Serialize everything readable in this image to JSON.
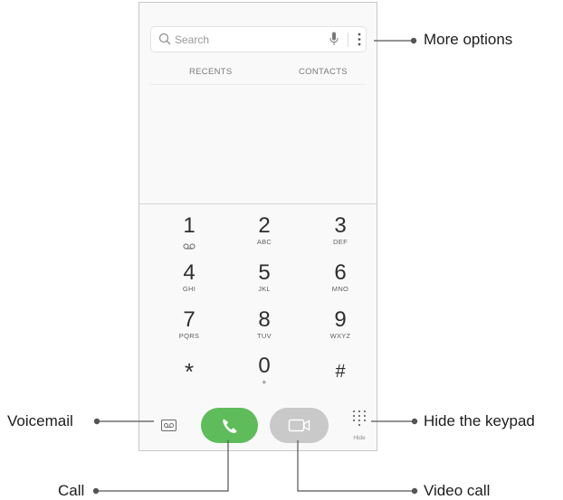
{
  "search": {
    "placeholder": "Search"
  },
  "tabs": [
    "RECENTS",
    "CONTACTS"
  ],
  "keypad": [
    {
      "digit": "1",
      "letters": ""
    },
    {
      "digit": "2",
      "letters": "ABC"
    },
    {
      "digit": "3",
      "letters": "DEF"
    },
    {
      "digit": "4",
      "letters": "GHI"
    },
    {
      "digit": "5",
      "letters": "JKL"
    },
    {
      "digit": "6",
      "letters": "MNO"
    },
    {
      "digit": "7",
      "letters": "PQRS"
    },
    {
      "digit": "8",
      "letters": "TUV"
    },
    {
      "digit": "9",
      "letters": "WXYZ"
    },
    {
      "digit": "*",
      "letters": ""
    },
    {
      "digit": "0",
      "letters": "+"
    },
    {
      "digit": "#",
      "letters": ""
    }
  ],
  "bottom": {
    "hide_label": "Hide"
  },
  "callouts": {
    "more_options": "More options",
    "voicemail": "Voicemail",
    "hide_keypad": "Hide the keypad",
    "call": "Call",
    "video_call": "Video call"
  },
  "colors": {
    "call_button": "#5fbc5a",
    "video_button": "#c9c9c9",
    "callout_line": "#555555"
  },
  "icons": [
    "search-icon",
    "mic-icon",
    "more-options-icon",
    "voicemail-icon",
    "phone-icon",
    "video-camera-icon",
    "keypad-grid-icon"
  ]
}
